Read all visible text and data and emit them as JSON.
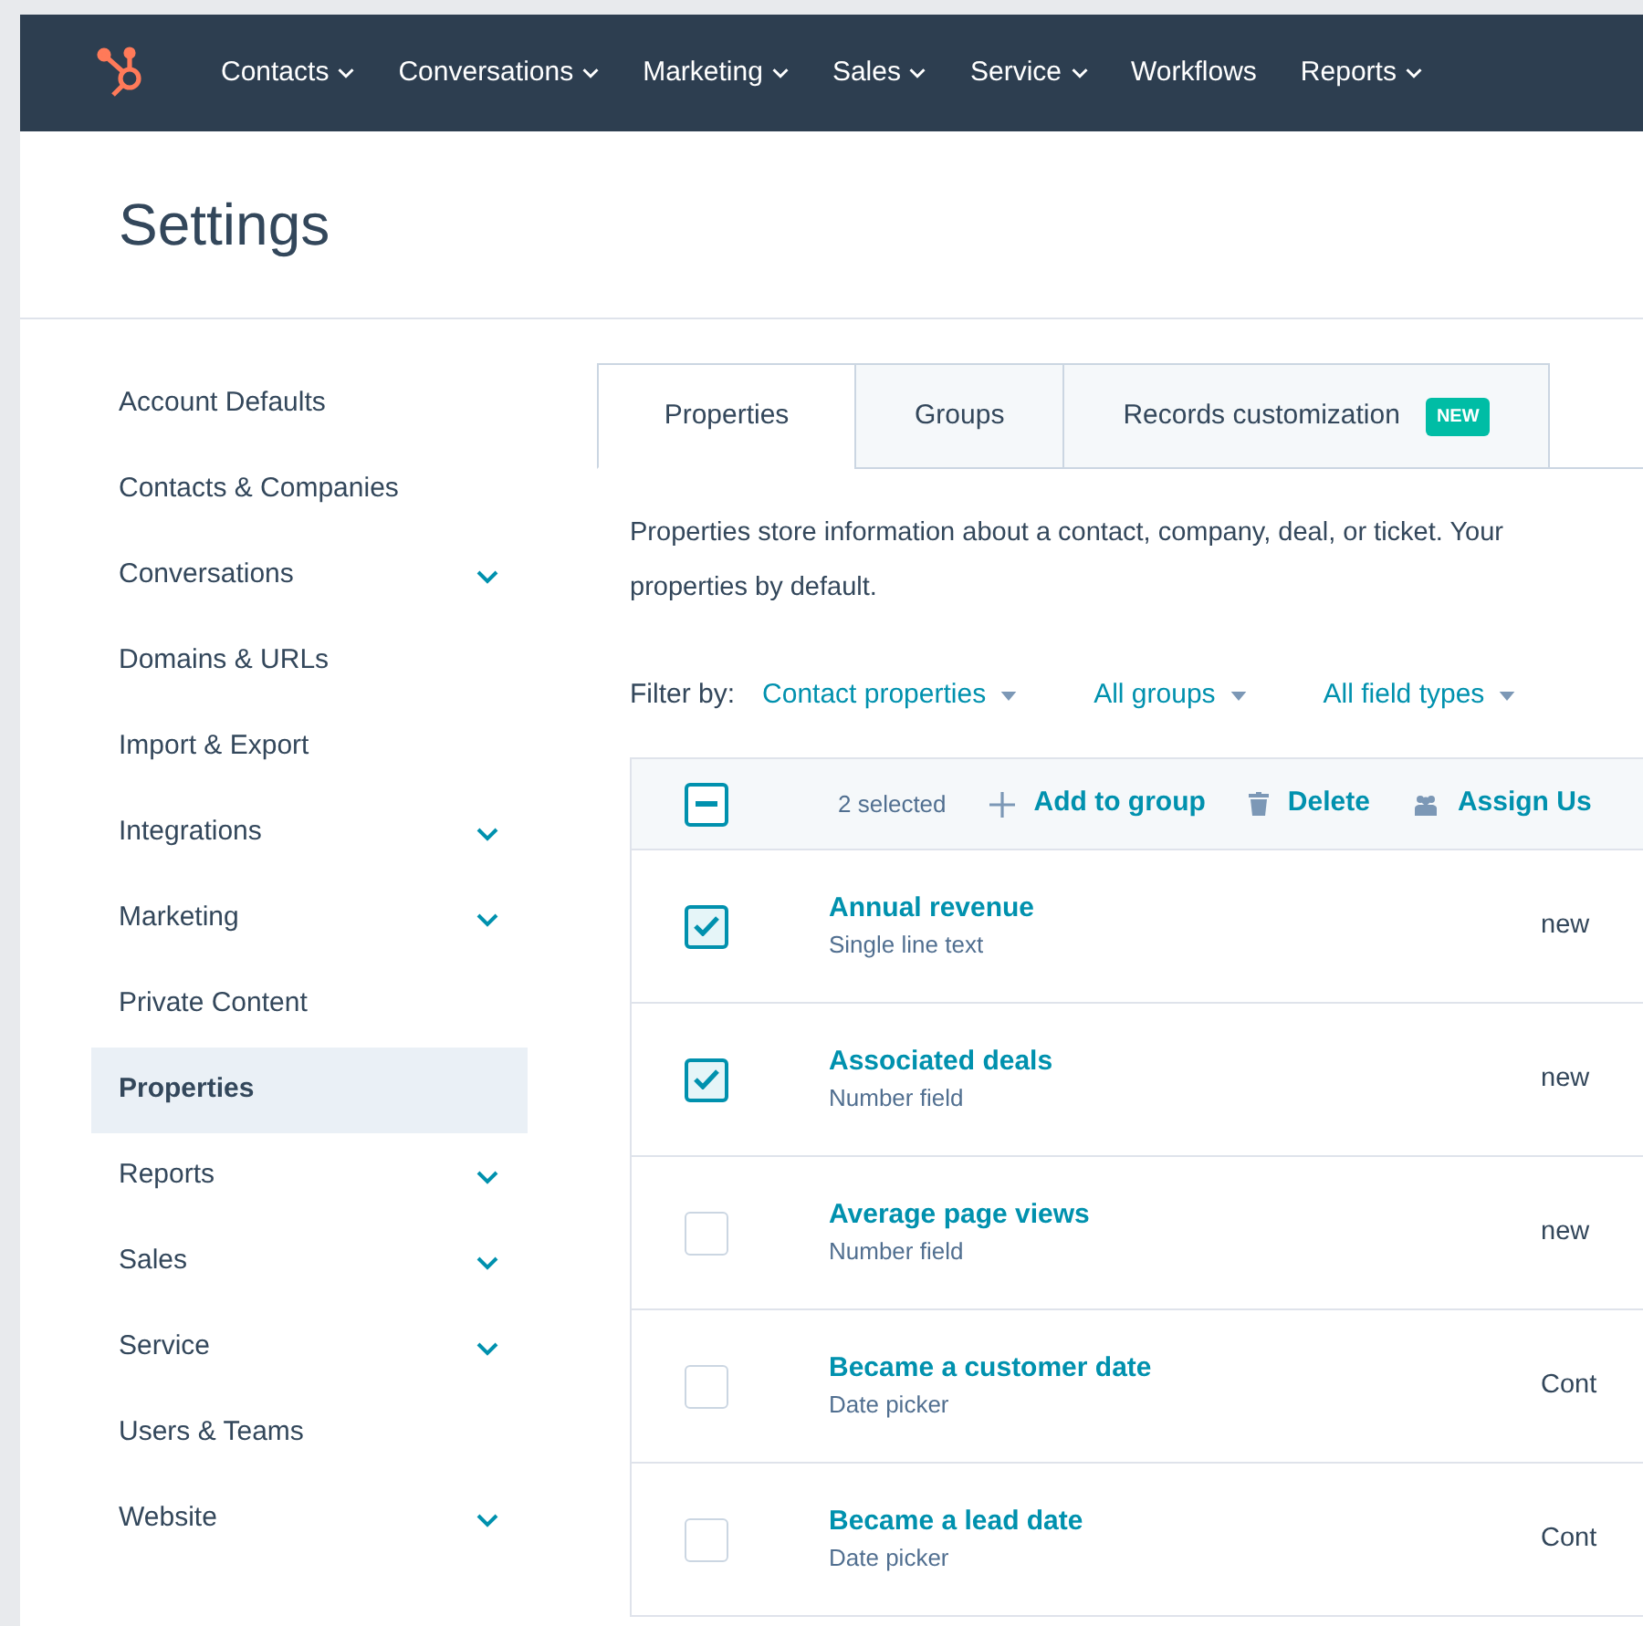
{
  "nav": {
    "items": [
      {
        "label": "Contacts",
        "dropdown": true
      },
      {
        "label": "Conversations",
        "dropdown": true
      },
      {
        "label": "Marketing",
        "dropdown": true
      },
      {
        "label": "Sales",
        "dropdown": true
      },
      {
        "label": "Service",
        "dropdown": true
      },
      {
        "label": "Workflows",
        "dropdown": false
      },
      {
        "label": "Reports",
        "dropdown": true
      }
    ]
  },
  "page_title": "Settings",
  "sidebar": {
    "items": [
      {
        "label": "Account Defaults",
        "expandable": false,
        "selected": false
      },
      {
        "label": "Contacts & Companies",
        "expandable": false,
        "selected": false
      },
      {
        "label": "Conversations",
        "expandable": true,
        "selected": false
      },
      {
        "label": "Domains & URLs",
        "expandable": false,
        "selected": false
      },
      {
        "label": "Import & Export",
        "expandable": false,
        "selected": false
      },
      {
        "label": "Integrations",
        "expandable": true,
        "selected": false
      },
      {
        "label": "Marketing",
        "expandable": true,
        "selected": false
      },
      {
        "label": "Private Content",
        "expandable": false,
        "selected": false
      },
      {
        "label": "Properties",
        "expandable": false,
        "selected": true
      },
      {
        "label": "Reports",
        "expandable": true,
        "selected": false
      },
      {
        "label": "Sales",
        "expandable": true,
        "selected": false
      },
      {
        "label": "Service",
        "expandable": true,
        "selected": false
      },
      {
        "label": "Users & Teams",
        "expandable": false,
        "selected": false
      },
      {
        "label": "Website",
        "expandable": true,
        "selected": false
      }
    ]
  },
  "tabs": [
    {
      "label": "Properties",
      "selected": true
    },
    {
      "label": "Groups",
      "selected": false
    },
    {
      "label": "Records customization",
      "selected": false,
      "badge": "NEW"
    }
  ],
  "description_lines": [
    "Properties store information about a contact, company, deal, or ticket. Your",
    "properties by default."
  ],
  "filter": {
    "label": "Filter by:",
    "options": [
      "Contact properties",
      "All groups",
      "All field types"
    ]
  },
  "table": {
    "header": {
      "select_all_indeterminate": true,
      "selected_count": "2 selected",
      "actions": [
        {
          "kind": "add",
          "label": "Add to group"
        },
        {
          "kind": "delete",
          "label": "Delete"
        },
        {
          "kind": "assign",
          "label": "Assign Us"
        }
      ]
    },
    "rows": [
      {
        "name": "Annual revenue",
        "type": "Single line text",
        "column_3": "new",
        "checked": true
      },
      {
        "name": "Associated deals",
        "type": "Number field",
        "column_3": "new",
        "checked": true
      },
      {
        "name": "Average page views",
        "type": "Number field",
        "column_3": "new",
        "checked": false
      },
      {
        "name": "Became a customer date",
        "type": "Date picker",
        "column_3": "Cont",
        "checked": false
      },
      {
        "name": "Became a lead date",
        "type": "Date picker",
        "column_3": "Cont",
        "checked": false
      }
    ]
  }
}
